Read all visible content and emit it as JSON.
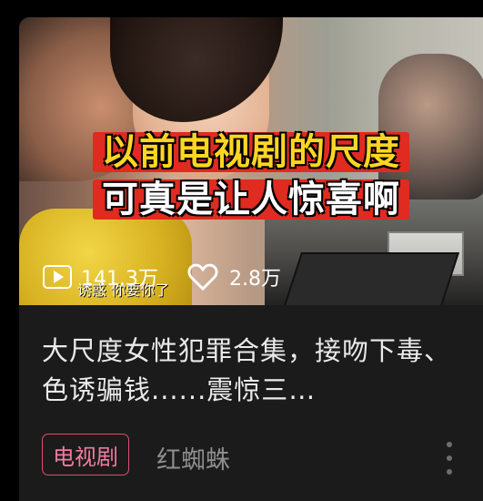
{
  "video": {
    "overlay_line1": "以前电视剧的尺度",
    "overlay_line2": "可真是让人惊喜啊",
    "subtitle": "诱惑 你要你了",
    "plays": "141.3万",
    "likes": "2.8万"
  },
  "title": "大尺度女性犯罪合集，接吻下毒、色诱骗钱......震惊三…",
  "tag": "电视剧",
  "channel": "红蜘蛛",
  "icons": {
    "play": "play-icon",
    "like": "heart-icon",
    "more": "more-vertical-icon"
  },
  "colors": {
    "background": "#000000",
    "card": "#1b1b1b",
    "tag_border": "#e04a73",
    "tag_text": "#f07aa0",
    "overlay_bg": "#e02b20",
    "overlay_yellow": "#ffd622"
  }
}
